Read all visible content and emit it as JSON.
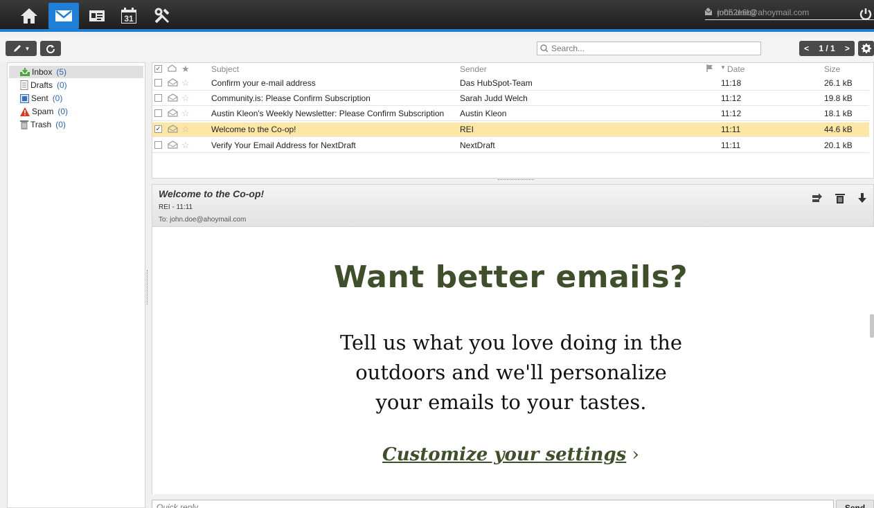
{
  "user": {
    "name": "m052e6b2",
    "email": "john.doe@ahoymail.com"
  },
  "nav": [
    {
      "icon": "home-icon",
      "active": false
    },
    {
      "icon": "mail-icon",
      "active": true
    },
    {
      "icon": "contacts-icon",
      "active": false
    },
    {
      "icon": "calendar-icon",
      "active": false,
      "text": "31"
    },
    {
      "icon": "settings-tools-icon",
      "active": false
    }
  ],
  "toolbar": {
    "search_placeholder": "Search...",
    "pager": "1 / 1",
    "prev": "<",
    "next": ">"
  },
  "folders": [
    {
      "name": "Inbox",
      "count": "(5)",
      "icon": "inbox-icon",
      "active": true
    },
    {
      "name": "Drafts",
      "count": "(0)",
      "icon": "drafts-icon",
      "active": false
    },
    {
      "name": "Sent",
      "count": "(0)",
      "icon": "sent-icon",
      "active": false
    },
    {
      "name": "Spam",
      "count": "(0)",
      "icon": "spam-icon",
      "active": false
    },
    {
      "name": "Trash",
      "count": "(0)",
      "icon": "trash-icon",
      "active": false
    }
  ],
  "list": {
    "columns": {
      "subject": "Subject",
      "sender": "Sender",
      "date": "Date",
      "size": "Size"
    },
    "rows": [
      {
        "subject": "Confirm your e-mail address",
        "sender": "Das HubSpot-Team",
        "date": "11:18",
        "size": "26.1 kB",
        "checked": false,
        "selected": false
      },
      {
        "subject": "Community.is: Please Confirm Subscription",
        "sender": "Sarah Judd Welch",
        "date": "11:12",
        "size": "19.8 kB",
        "checked": false,
        "selected": false
      },
      {
        "subject": "Austin Kleon's Weekly Newsletter: Please Confirm Subscription",
        "sender": "Austin Kleon",
        "date": "11:12",
        "size": "18.1 kB",
        "checked": false,
        "selected": false
      },
      {
        "subject": "Welcome to the Co-op!",
        "sender": "REI",
        "date": "11:11",
        "size": "44.6 kB",
        "checked": true,
        "selected": true
      },
      {
        "subject": "Verify Your Email Address for NextDraft",
        "sender": "NextDraft",
        "date": "11:11",
        "size": "20.1 kB",
        "checked": false,
        "selected": false
      }
    ]
  },
  "preview": {
    "subject": "Welcome to the Co-op!",
    "from_line": "REI - 11:11",
    "to_line": "To: john.doe@ahoymail.com",
    "headline": "Want better emails?",
    "body_lines": [
      "Tell us what you love doing in the",
      "outdoors and we'll personalize",
      "your emails to your tastes."
    ],
    "cta_link": "Customize your settings",
    "cta_arrow": "›"
  },
  "reply": {
    "placeholder": "Quick reply",
    "send_label": "Send"
  },
  "colors": {
    "accent": "#1f7fd6",
    "selected_row": "#fde6a6",
    "email_green": "#3f4e2b"
  }
}
